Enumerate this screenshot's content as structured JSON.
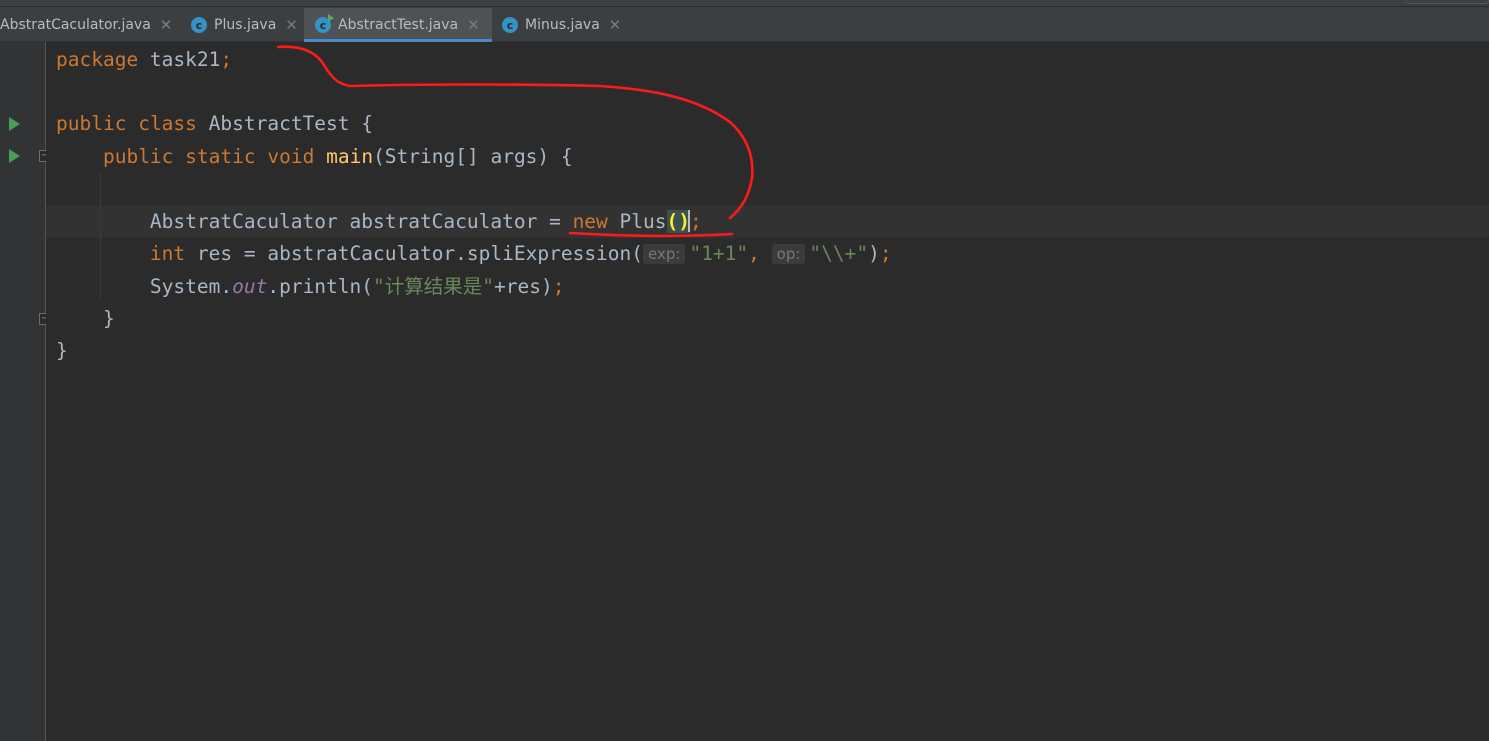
{
  "tabs": [
    {
      "label": "AbstratCaculator.java",
      "icon": "none",
      "active": false
    },
    {
      "label": "Plus.java",
      "icon": "class-icon",
      "active": false
    },
    {
      "label": "AbstractTest.java",
      "icon": "class-runnable-icon",
      "active": true
    },
    {
      "label": "Minus.java",
      "icon": "class-icon",
      "active": false
    }
  ],
  "tab_close_glyph": "✕",
  "code": {
    "l1": {
      "kw": "package",
      "rest": " task21",
      "semi": ";"
    },
    "l3": {
      "kw1": "public",
      "kw2": "class",
      "name": " AbstractTest {"
    },
    "l4": {
      "kw1": "public",
      "kw2": "static",
      "kw3": "void",
      "fn": "main",
      "rest": "(String[] args) {"
    },
    "l6": {
      "a": "AbstratCaculator abstratCaculator = ",
      "kw": "new",
      "b": " Plus",
      "paren": "()",
      "semi": ";"
    },
    "l7": {
      "kw": "int",
      "a": " res = abstratCaculator.spliExpression(",
      "hint1": "exp:",
      "str1": "\"1+1\"",
      "comma": ",",
      "hint2": "op:",
      "str2": "\"\\\\+\"",
      "end": ")",
      "semi": ";"
    },
    "l8": {
      "a": "System.",
      "fld": "out",
      "b": ".println(",
      "str": "\"计算结果是\"",
      "c": "+res)",
      "semi": ";"
    },
    "l9": {
      "a": "}"
    },
    "l10": {
      "a": "}"
    }
  },
  "colors": {
    "background": "#2b2b2b",
    "keyword": "#cc7832",
    "function": "#ffc66d",
    "string": "#6a8759",
    "field": "#9876aa",
    "annotation": "#ff0000"
  }
}
